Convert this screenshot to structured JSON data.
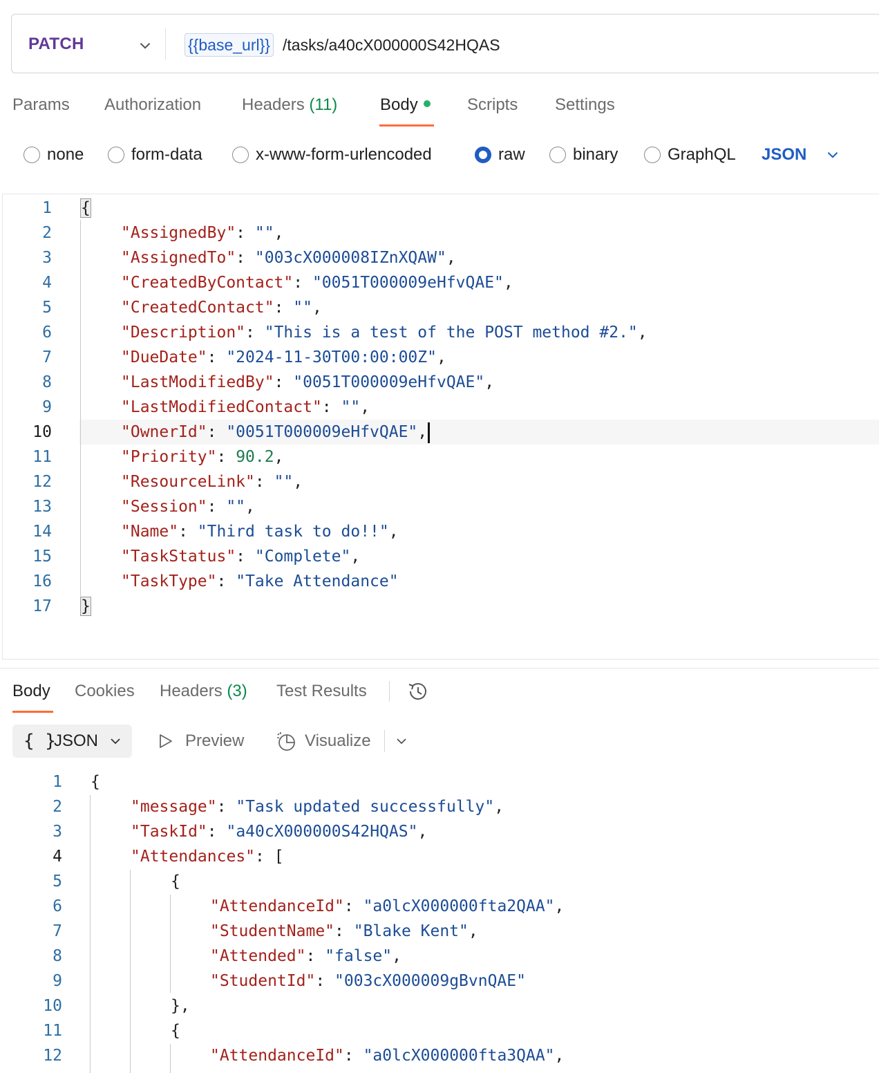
{
  "request": {
    "method": "PATCH",
    "url_variable": "{{base_url}}",
    "url_path": "/tasks/a40cX000000S42HQAS"
  },
  "request_tabs": {
    "params": "Params",
    "authorization": "Authorization",
    "headers": "Headers",
    "headers_count": "(11)",
    "body": "Body",
    "scripts": "Scripts",
    "settings": "Settings"
  },
  "body_types": {
    "none": "none",
    "form_data": "form-data",
    "urlencoded": "x-www-form-urlencoded",
    "raw": "raw",
    "binary": "binary",
    "graphql": "GraphQL",
    "selected": "raw",
    "format": "JSON"
  },
  "request_body": {
    "line_numbers": [
      "1",
      "2",
      "3",
      "4",
      "5",
      "6",
      "7",
      "8",
      "9",
      "10",
      "11",
      "12",
      "13",
      "14",
      "15",
      "16",
      "17"
    ],
    "current_line": "10",
    "open_brace": "{",
    "close_brace": "}",
    "fields": [
      {
        "key": "\"AssignedBy\"",
        "value": "\"\"",
        "trail": ","
      },
      {
        "key": "\"AssignedTo\"",
        "value": "\"003cX000008IZnXQAW\"",
        "trail": ","
      },
      {
        "key": "\"CreatedByContact\"",
        "value": "\"0051T000009eHfvQAE\"",
        "trail": ","
      },
      {
        "key": "\"CreatedContact\"",
        "value": "\"\"",
        "trail": ","
      },
      {
        "key": "\"Description\"",
        "value": "\"This is a test of the POST method #2.\"",
        "trail": ","
      },
      {
        "key": "\"DueDate\"",
        "value": "\"2024-11-30T00:00:00Z\"",
        "trail": ","
      },
      {
        "key": "\"LastModifiedBy\"",
        "value": "\"0051T000009eHfvQAE\"",
        "trail": ","
      },
      {
        "key": "\"LastModifiedContact\"",
        "value": "\"\"",
        "trail": ","
      },
      {
        "key": "\"OwnerId\"",
        "value": "\"0051T000009eHfvQAE\"",
        "trail": ","
      },
      {
        "key": "\"Priority\"",
        "value": "90.2",
        "trail": ","
      },
      {
        "key": "\"ResourceLink\"",
        "value": "\"\"",
        "trail": ","
      },
      {
        "key": "\"Session\"",
        "value": "\"\"",
        "trail": ","
      },
      {
        "key": "\"Name\"",
        "value": "\"Third task to do!!\"",
        "trail": ","
      },
      {
        "key": "\"TaskStatus\"",
        "value": "\"Complete\"",
        "trail": ","
      },
      {
        "key": "\"TaskType\"",
        "value": "\"Take Attendance\"",
        "trail": ""
      }
    ]
  },
  "response_tabs": {
    "body": "Body",
    "cookies": "Cookies",
    "headers": "Headers",
    "headers_count": "(3)",
    "test_results": "Test Results"
  },
  "response_toolbar": {
    "format_braces": "{ }",
    "format": "JSON",
    "preview": "Preview",
    "visualize": "Visualize"
  },
  "response_body": {
    "line_numbers": [
      "1",
      "2",
      "3",
      "4",
      "5",
      "6",
      "7",
      "8",
      "9",
      "10",
      "11",
      "12"
    ],
    "current_line": "4",
    "lines": {
      "l1": "{",
      "l2_key": "\"message\"",
      "l2_val": "\"Task updated successfully\"",
      "l3_key": "\"TaskId\"",
      "l3_val": "\"a40cX000000S42HQAS\"",
      "l4_key": "\"Attendances\"",
      "l4_bracket": "[",
      "l5": "{",
      "l6_key": "\"AttendanceId\"",
      "l6_val": "\"a0lcX000000fta2QAA\"",
      "l7_key": "\"StudentName\"",
      "l7_val": "\"Blake Kent\"",
      "l8_key": "\"Attended\"",
      "l8_val": "\"false\"",
      "l9_key": "\"StudentId\"",
      "l9_val": "\"003cX000009gBvnQAE\"",
      "l10": "},",
      "l11": "{",
      "l12_key": "\"AttendanceId\"",
      "l12_val": "\"a0lcX000000fta3QAA\""
    }
  },
  "colors": {
    "method": "#623897",
    "accent": "#ff6c37",
    "link": "#1f5cc4",
    "json_key": "#a3221b",
    "json_string": "#1c4c95",
    "json_number": "#1f7a52",
    "status_dot": "#26b069"
  }
}
